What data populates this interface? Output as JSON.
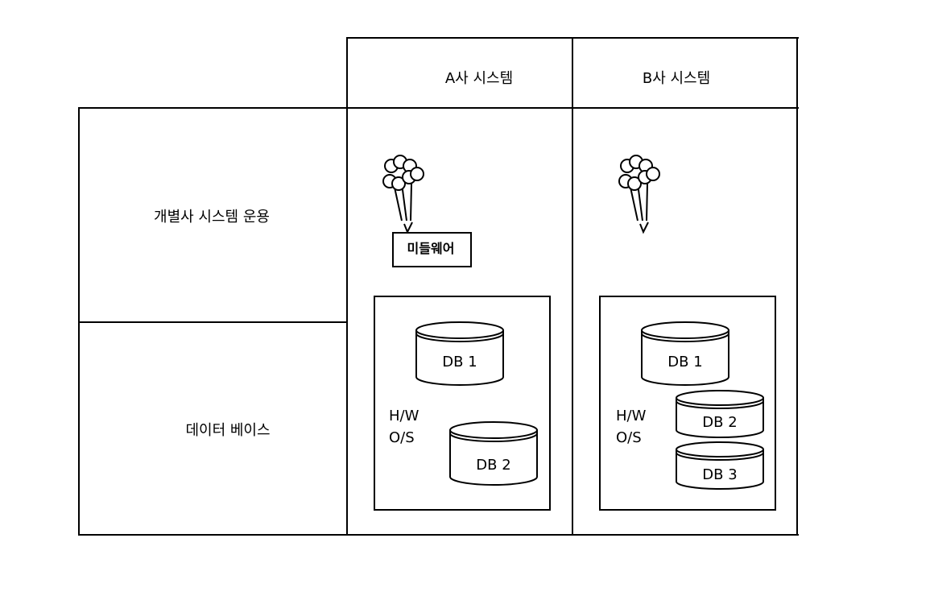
{
  "header": {
    "col_a": "A사 시스템",
    "col_b": "B사 시스템"
  },
  "rows": {
    "operation": "개별사 시스템 운용",
    "database": "데이터 베이스"
  },
  "a_system": {
    "middleware": "미들웨어",
    "hw_line1": "H/W",
    "hw_line2": "O/S",
    "db1": "DB 1",
    "db2": "DB 2"
  },
  "b_system": {
    "hw_line1": "H/W",
    "hw_line2": "O/S",
    "db1": "DB 1",
    "db2": "DB 2",
    "db3": "DB 3"
  }
}
